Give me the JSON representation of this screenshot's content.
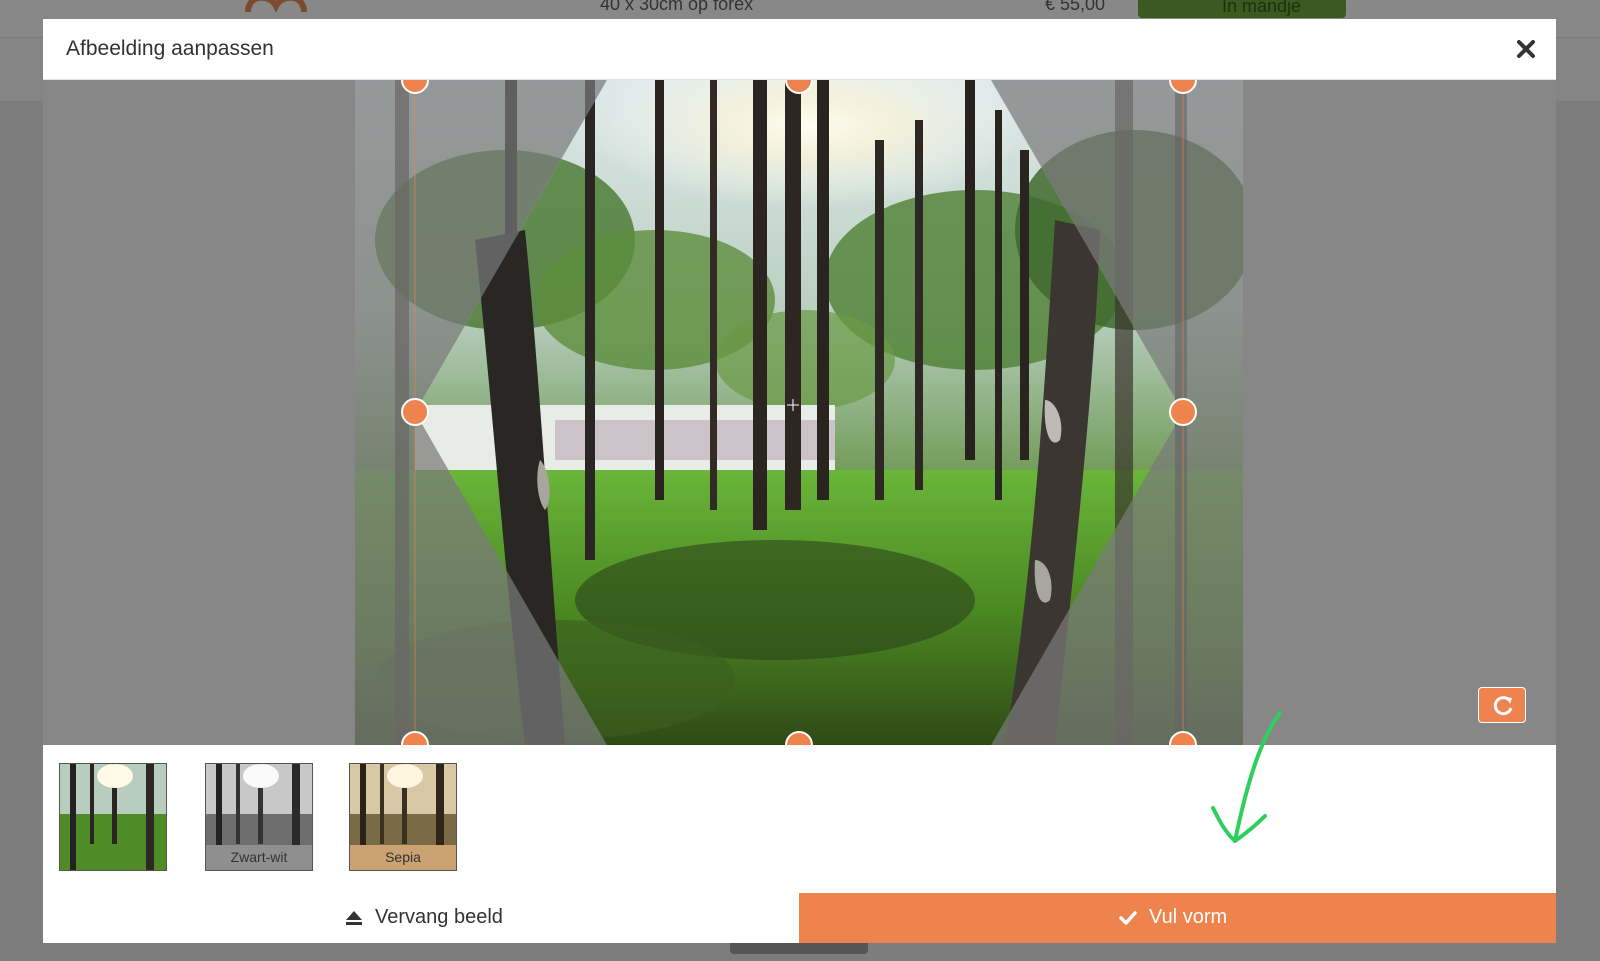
{
  "background_page": {
    "product_title": "40 x 30cm op forex",
    "price": "€ 55,00",
    "cart_button": "In mandje"
  },
  "modal": {
    "title": "Afbeelding aanpassen",
    "close_icon": "close-icon"
  },
  "editor": {
    "shape": "hexagon",
    "handles": 8,
    "reset_icon": "rotate-reset-icon"
  },
  "filters": [
    {
      "label": "",
      "type": "original"
    },
    {
      "label": "Zwart-wit",
      "type": "grayscale"
    },
    {
      "label": "Sepia",
      "type": "sepia"
    }
  ],
  "footer": {
    "replace_label": "Vervang beeld",
    "replace_icon": "eject-icon",
    "fill_label": "Vul vorm",
    "fill_icon": "check-icon"
  },
  "colors": {
    "accent": "#ef834e",
    "annotation": "#2fcf5e",
    "overlay": "#878787"
  }
}
